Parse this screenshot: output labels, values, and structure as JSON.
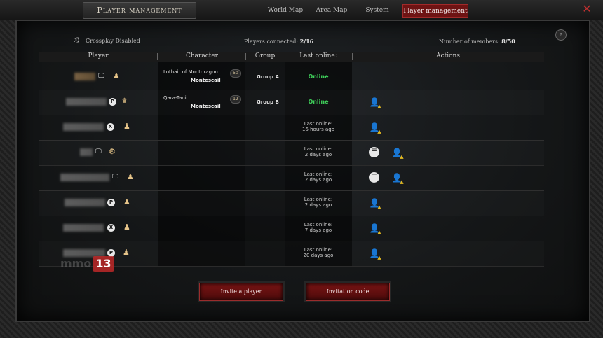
{
  "window": {
    "title": "Player management",
    "tabs": [
      {
        "label": "World Map"
      },
      {
        "label": "Area Map"
      },
      {
        "label": "System"
      },
      {
        "label": "Player management"
      }
    ],
    "close_icon": "close-icon"
  },
  "header": {
    "crossplay_label": "Crossplay",
    "crossplay_value": "Disabled",
    "players_connected_label": "Players connected:",
    "players_connected_value": "2/16",
    "members_label": "Number of members:",
    "members_value": "8/50"
  },
  "table": {
    "columns": [
      "Player",
      "Character",
      "Group",
      "Last online:",
      "Actions"
    ],
    "rows": [
      {
        "platform": "pc",
        "role": "member",
        "character": "Lothair of Montdragon",
        "location": "Montescail",
        "level": "50",
        "group": "Group A",
        "status": "Online",
        "last_online_label": "",
        "last_online_value": "",
        "actions": []
      },
      {
        "platform": "playstation",
        "role": "leader",
        "character": "Qara-Tani",
        "location": "Montescail",
        "level": "12",
        "group": "Group B",
        "status": "Online",
        "last_online_label": "",
        "last_online_value": "",
        "actions": [
          "kick"
        ]
      },
      {
        "platform": "xbox",
        "role": "member",
        "character": "",
        "location": "",
        "level": "",
        "group": "",
        "status": "",
        "last_online_label": "Last online:",
        "last_online_value": "16 hours ago",
        "actions": [
          "kick"
        ]
      },
      {
        "platform": "pc",
        "role": "officer",
        "character": "",
        "location": "",
        "level": "",
        "group": "",
        "status": "",
        "last_online_label": "Last online:",
        "last_online_value": "2 days ago",
        "actions": [
          "manage",
          "kick"
        ]
      },
      {
        "platform": "pc",
        "role": "member",
        "character": "",
        "location": "",
        "level": "",
        "group": "",
        "status": "",
        "last_online_label": "Last online:",
        "last_online_value": "2 days ago",
        "actions": [
          "manage",
          "kick"
        ]
      },
      {
        "platform": "playstation",
        "role": "member",
        "character": "",
        "location": "",
        "level": "",
        "group": "",
        "status": "",
        "last_online_label": "Last online:",
        "last_online_value": "2 days ago",
        "actions": [
          "kick"
        ]
      },
      {
        "platform": "xbox",
        "role": "member",
        "character": "",
        "location": "",
        "level": "",
        "group": "",
        "status": "",
        "last_online_label": "Last online:",
        "last_online_value": "7 days ago",
        "actions": [
          "kick"
        ]
      },
      {
        "platform": "playstation",
        "role": "member",
        "character": "",
        "location": "",
        "level": "",
        "group": "",
        "status": "",
        "last_online_label": "Last online:",
        "last_online_value": "20 days ago",
        "actions": [
          "kick"
        ]
      }
    ]
  },
  "buttons": {
    "invite": "Invite a player",
    "code": "Invitation code"
  },
  "watermark": {
    "text": "mmo",
    "number": "13"
  },
  "colors": {
    "accent_red": "#6e1313",
    "online_green": "#3fcf5a",
    "role_gold": "#e6c489"
  }
}
